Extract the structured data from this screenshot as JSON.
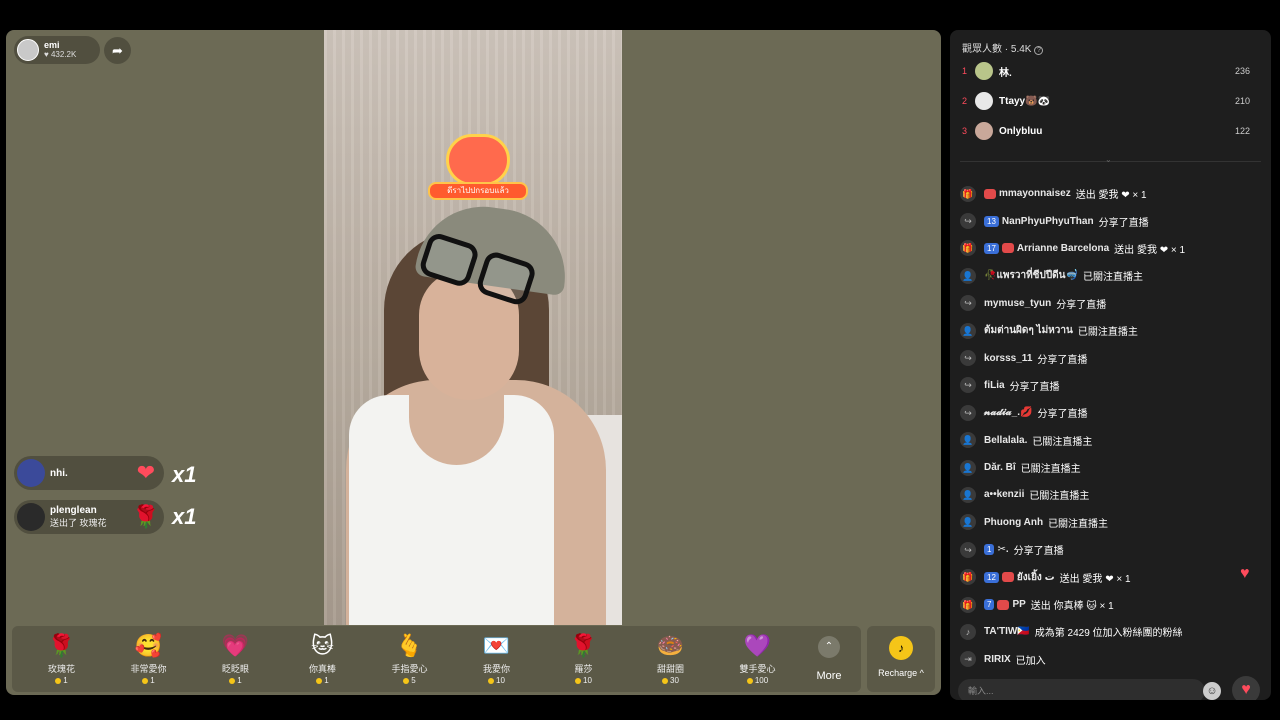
{
  "host": {
    "name": "emi",
    "likes": "432.2K"
  },
  "sticker": {
    "label": "ดีราไปปกรอบแล้ว"
  },
  "gift_notifications": [
    {
      "name": "nhi.",
      "sub": "",
      "icon": "❤",
      "mult": "x1"
    },
    {
      "name": "plenglean",
      "sub": "送出了 玫瑰花",
      "icon": "🌹",
      "mult": "x1"
    }
  ],
  "gifts": [
    {
      "name": "玫瑰花",
      "price": "1",
      "icon": "🌹"
    },
    {
      "name": "非常愛你",
      "price": "1",
      "icon": "🥰"
    },
    {
      "name": "眨眨眼",
      "price": "1",
      "icon": "💗"
    },
    {
      "name": "你真棒",
      "price": "1",
      "icon": "🐱"
    },
    {
      "name": "手指愛心",
      "price": "5",
      "icon": "🫰"
    },
    {
      "name": "我愛你",
      "price": "10",
      "icon": "💌"
    },
    {
      "name": "羅莎",
      "price": "10",
      "icon": "🌹"
    },
    {
      "name": "甜甜圈",
      "price": "30",
      "icon": "🍩"
    },
    {
      "name": "雙手愛心",
      "price": "100",
      "icon": "💜"
    }
  ],
  "more_label": "More",
  "recharge_label": "Recharge ^",
  "viewers": {
    "label": "觀眾人數",
    "count": "5.4K"
  },
  "ranking": [
    {
      "rank": "1",
      "name": "林.",
      "value": "236"
    },
    {
      "rank": "2",
      "name": "Ttayy🐻🐼",
      "value": "210"
    },
    {
      "rank": "3",
      "name": "Onlybluu",
      "value": "122"
    }
  ],
  "chat": [
    {
      "icon": "🎁",
      "badge": "",
      "fan": true,
      "user": "mmayonnaisez",
      "action": "送出 愛我 ❤ × 1"
    },
    {
      "icon": "↪",
      "badge": "13",
      "fan": false,
      "user": "NanPhyuPhyuThan",
      "action": "分享了直播"
    },
    {
      "icon": "🎁",
      "badge": "17",
      "fan": true,
      "user": "Arrianne Barcelona",
      "action": "送出 愛我 ❤ × 1"
    },
    {
      "icon": "👤",
      "badge": "",
      "fan": false,
      "user": "🥀แพรวาที่ชีปปีดีน🤿",
      "action": "已關注直播主"
    },
    {
      "icon": "↪",
      "badge": "",
      "fan": false,
      "user": "mymuse_tyun",
      "action": "分享了直播"
    },
    {
      "icon": "👤",
      "badge": "",
      "fan": false,
      "user": "ต้มต่านผิดๆ ไม่หวาน",
      "action": "已關注直播主"
    },
    {
      "icon": "↪",
      "badge": "",
      "fan": false,
      "user": "korsss_11",
      "action": "分享了直播"
    },
    {
      "icon": "↪",
      "badge": "",
      "fan": false,
      "user": "fiLia",
      "action": "分享了直播"
    },
    {
      "icon": "↪",
      "badge": "",
      "fan": false,
      "user": "𝓷𝓪𝓭𝓲𝓪_.💋",
      "action": "分享了直播"
    },
    {
      "icon": "👤",
      "badge": "",
      "fan": false,
      "user": "Bellalala.",
      "action": "已關注直播主"
    },
    {
      "icon": "👤",
      "badge": "",
      "fan": false,
      "user": "Dăr. Bî",
      "action": "已關注直播主"
    },
    {
      "icon": "👤",
      "badge": "",
      "fan": false,
      "user": "a••kenzii",
      "action": "已關注直播主"
    },
    {
      "icon": "👤",
      "badge": "",
      "fan": false,
      "user": "Phuong Anh",
      "action": "已關注直播主"
    },
    {
      "icon": "↪",
      "badge": "1",
      "fan": false,
      "user": "✂.",
      "action": "分享了直播"
    },
    {
      "icon": "🎁",
      "badge": "12",
      "fan": true,
      "user": "ยังเยิ้ง ت",
      "action": "送出 愛我 ❤ × 1"
    },
    {
      "icon": "🎁",
      "badge": "7",
      "fan": true,
      "user": "PP",
      "action": "送出 你真棒 🐱 × 1"
    },
    {
      "icon": "♪",
      "badge": "",
      "fan": false,
      "user": "TA'TIW🇵🇭",
      "action": "成為第 2429 位加入粉絲團的粉絲"
    },
    {
      "icon": "⇥",
      "badge": "",
      "fan": false,
      "user": "RIRIX",
      "action": "已加入"
    }
  ],
  "input": {
    "placeholder": "輸入..."
  }
}
